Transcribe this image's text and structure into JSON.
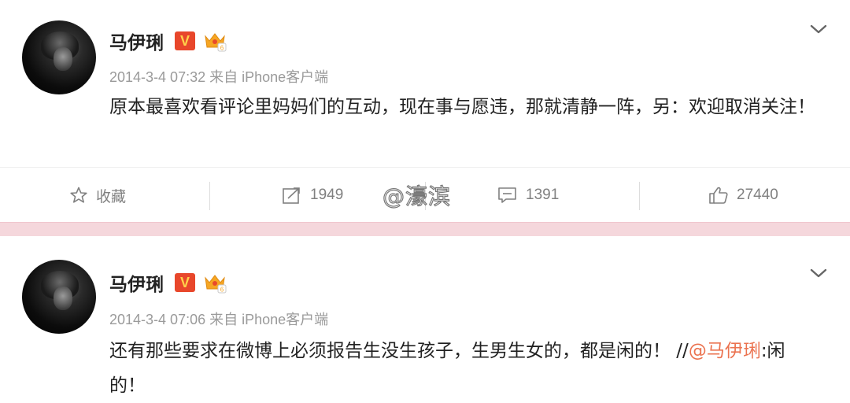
{
  "posts": [
    {
      "username": "马伊琍",
      "verified_badge": "V",
      "meta": "2014-3-4 07:32 来自 iPhone客户端",
      "content": "原本最喜欢看评论里妈妈们的互动，现在事与愿违，那就清静一阵，另：欢迎取消关注！",
      "actions": {
        "favorite_label": "收藏",
        "repost_count": "1949",
        "comment_count": "1391",
        "like_count": "27440"
      }
    },
    {
      "username": "马伊琍",
      "verified_badge": "V",
      "meta": "2014-3-4 07:06 来自 iPhone客户端",
      "content_main": "还有那些要求在微博上必须报告生没生孩子，生男生女的，都是闲的！ //",
      "content_mention": "@马伊琍",
      "content_tail": ":闲的！"
    }
  ],
  "watermark": "@濠滨",
  "colors": {
    "verified_badge_bg": "#e8472b",
    "mention": "#eb7350",
    "separator": "#f5d7dc",
    "meta_text": "#9a9a9a"
  },
  "icons": [
    "avatar",
    "verified-v-icon",
    "vip-crown-icon",
    "chevron-down-icon",
    "star-icon",
    "repost-icon",
    "comment-icon",
    "thumbs-up-icon"
  ]
}
